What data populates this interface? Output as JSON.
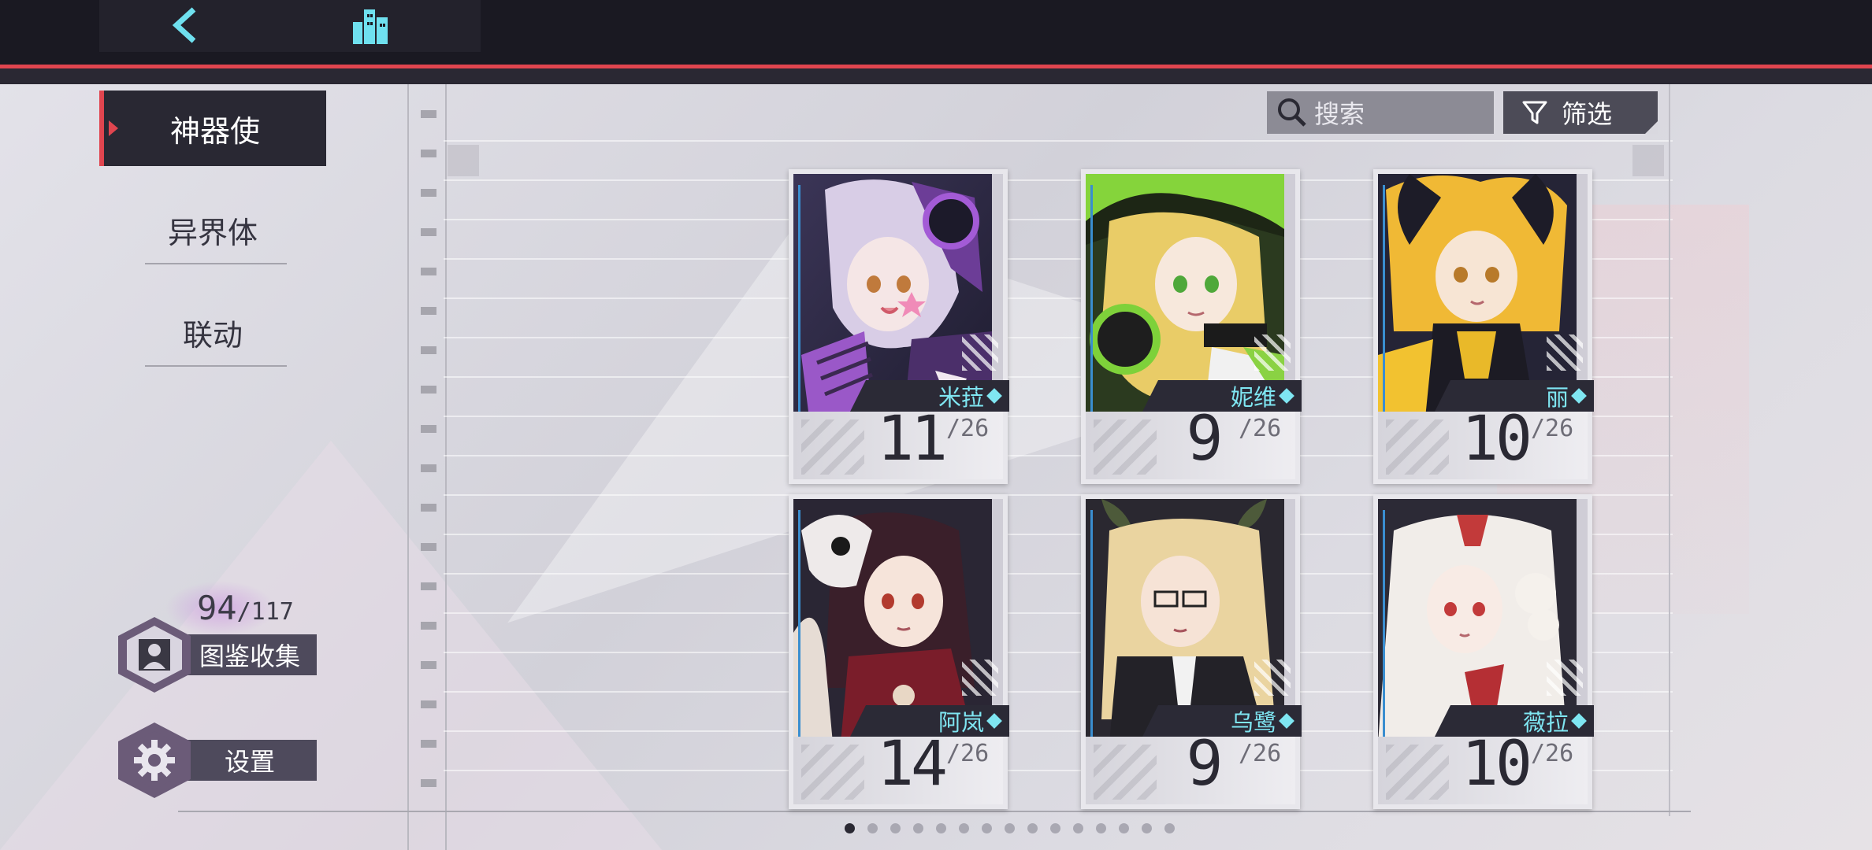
{
  "tabs": [
    {
      "label": "神器使",
      "active": true
    },
    {
      "label": "异界体",
      "active": false
    },
    {
      "label": "联动",
      "active": false
    }
  ],
  "search": {
    "placeholder": "搜索"
  },
  "filter": {
    "label": "筛选"
  },
  "cards": [
    {
      "name": "米菈",
      "count": "11",
      "total": "/26"
    },
    {
      "name": "妮维",
      "count": "9",
      "total": "/26"
    },
    {
      "name": "丽",
      "count": "10",
      "total": "/26"
    },
    {
      "name": "阿岚",
      "count": "14",
      "total": "/26"
    },
    {
      "name": "乌鹭",
      "count": "9",
      "total": "/26"
    },
    {
      "name": "薇拉",
      "count": "10",
      "total": "/26"
    }
  ],
  "collection": {
    "count": "94",
    "total": "/117",
    "label": "图鉴收集"
  },
  "settings": {
    "label": "设置"
  },
  "pagination": {
    "total": 15,
    "current": 1
  },
  "colors": {
    "accent_red": "#e0454f",
    "name_cyan": "#7fe6f2",
    "topbar": "#1a1922"
  },
  "icons": {
    "back": "chevron-left-icon",
    "city": "city-buildings-icon",
    "search": "search-icon",
    "filter": "funnel-icon",
    "collection": "person-portrait-icon",
    "settings": "gear-icon"
  }
}
